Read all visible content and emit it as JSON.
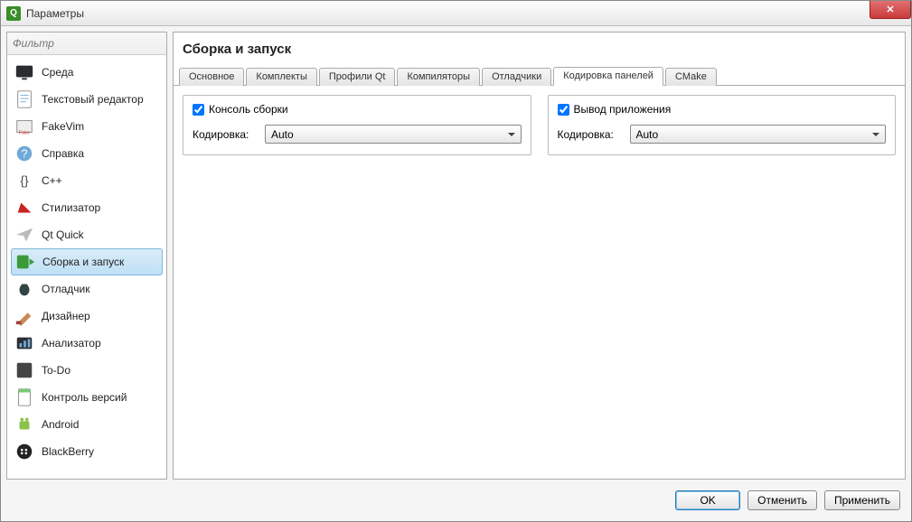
{
  "window": {
    "title": "Параметры"
  },
  "filter": {
    "placeholder": "Фильтр"
  },
  "sidebar": {
    "items": [
      {
        "label": "Среда"
      },
      {
        "label": "Текстовый редактор"
      },
      {
        "label": "FakeVim"
      },
      {
        "label": "Справка"
      },
      {
        "label": "C++"
      },
      {
        "label": "Стилизатор"
      },
      {
        "label": "Qt Quick"
      },
      {
        "label": "Сборка и запуск",
        "selected": true
      },
      {
        "label": "Отладчик"
      },
      {
        "label": "Дизайнер"
      },
      {
        "label": "Анализатор"
      },
      {
        "label": "To-Do"
      },
      {
        "label": "Контроль версий"
      },
      {
        "label": "Android"
      },
      {
        "label": "BlackBerry"
      }
    ]
  },
  "page": {
    "title": "Сборка и запуск",
    "tabs": [
      {
        "label": "Основное"
      },
      {
        "label": "Комплекты"
      },
      {
        "label": "Профили Qt"
      },
      {
        "label": "Компиляторы"
      },
      {
        "label": "Отладчики"
      },
      {
        "label": "Кодировка панелей",
        "active": true
      },
      {
        "label": "CMake"
      }
    ],
    "left_group": {
      "check_label": "Консоль сборки",
      "checked": true,
      "encoding_label": "Кодировка:",
      "encoding_value": "Auto"
    },
    "right_group": {
      "check_label": "Вывод приложения",
      "checked": true,
      "encoding_label": "Кодировка:",
      "encoding_value": "Auto"
    }
  },
  "footer": {
    "ok": "OK",
    "cancel": "Отменить",
    "apply": "Применить"
  }
}
